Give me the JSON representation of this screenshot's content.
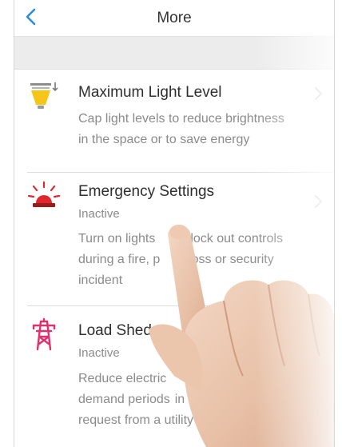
{
  "nav": {
    "title": "More",
    "back_icon": "chevron-left-icon"
  },
  "items": [
    {
      "title": "Maximum Light Level",
      "status": "",
      "description": [
        "Cap light levels to reduce brightness",
        "in the space or to save energy"
      ],
      "icon": "light-bulb-down-icon"
    },
    {
      "title": "Emergency Settings",
      "status": "Inactive",
      "description": [
        "Turn on lights",
        "lock out controls",
        "during a fire, p",
        "r loss or security",
        "incident"
      ],
      "icon": "emergency-siren-icon"
    },
    {
      "title": "Load Shed",
      "status": "Inactive",
      "description": [
        "Reduce electric",
        "at peak",
        "demand periods",
        "in response to a",
        "request from a utility company"
      ],
      "icon": "power-tower-icon"
    }
  ],
  "colors": {
    "accent_blue": "#2a8fd8",
    "bulb_yellow": "#f5c518",
    "emergency_red": "#e0272c",
    "tower_pink": "#e0306e"
  }
}
